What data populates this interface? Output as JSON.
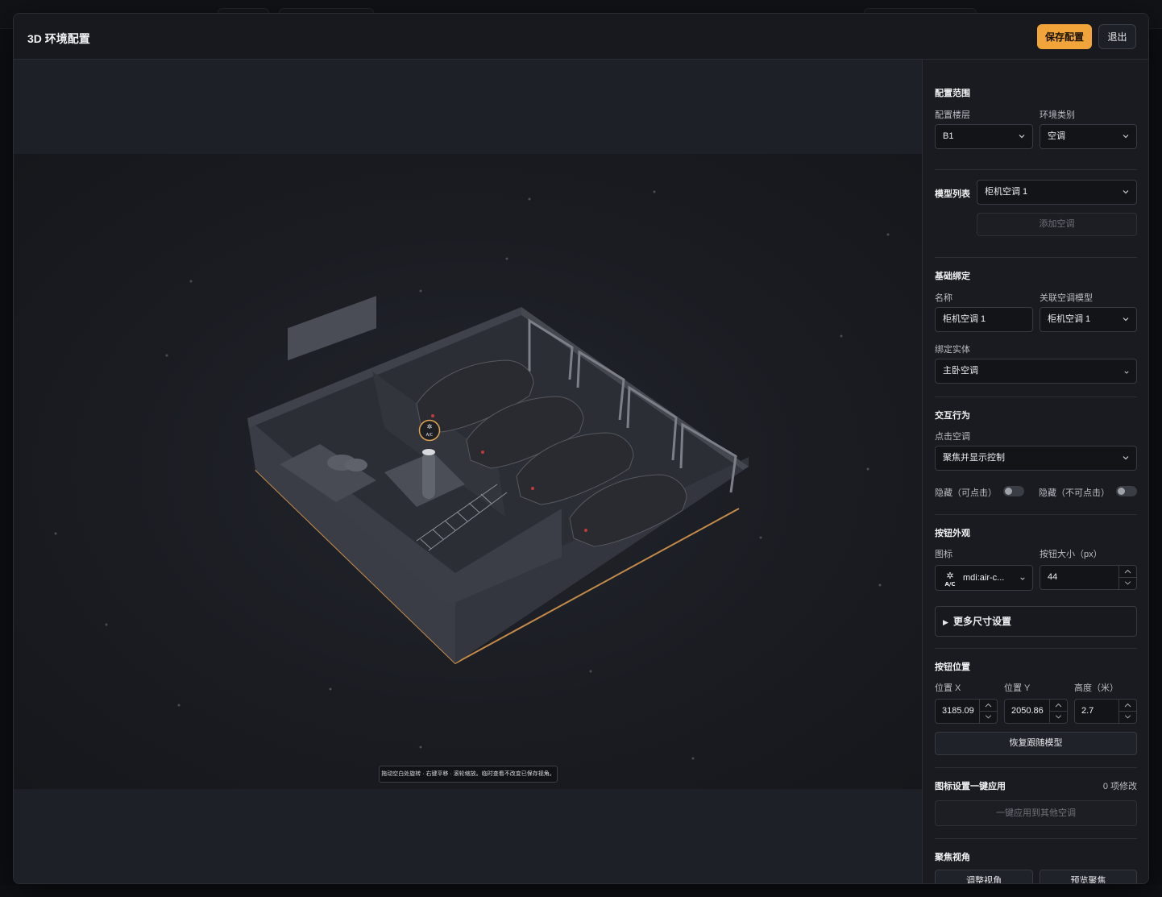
{
  "modal": {
    "title": "3D 环境配置",
    "save_label": "保存配置",
    "exit_label": "退出"
  },
  "viewport": {
    "hint": "拖动空白处旋转 · 右键平移 · 滚轮缩放。临时查看不改变已保存视角。",
    "ac_marker": "A/C"
  },
  "panel": {
    "scope": {
      "title": "配置范围",
      "floor_label": "配置楼层",
      "floor_value": "B1",
      "env_label": "环境类别",
      "env_value": "空调"
    },
    "models": {
      "title": "模型列表",
      "selected": "柜机空调 1",
      "add_label": "添加空调"
    },
    "binding": {
      "title": "基础绑定",
      "name_label": "名称",
      "name_value": "柜机空调 1",
      "model_label": "关联空调模型",
      "model_value": "柜机空调 1",
      "entity_label": "绑定实体",
      "entity_value": "主卧空调"
    },
    "interaction": {
      "title": "交互行为",
      "click_label": "点击空调",
      "click_value": "聚焦并显示控制",
      "hide_clickable": "隐藏（可点击）",
      "hide_unclickable": "隐藏（不可点击）"
    },
    "appearance": {
      "title": "按钮外观",
      "icon_label": "图标",
      "icon_value": "mdi:air-c...",
      "size_label": "按钮大小（px）",
      "size_value": "44",
      "more_label": "更多尺寸设置"
    },
    "position": {
      "title": "按钮位置",
      "x_label": "位置 X",
      "x_value": "3185.09",
      "y_label": "位置 Y",
      "y_value": "2050.86",
      "h_label": "高度（米）",
      "h_value": "2.7",
      "restore_label": "恢复跟随模型"
    },
    "apply": {
      "title": "图标设置一键应用",
      "count": "0 项修改",
      "apply_label": "一键应用到其他空调"
    },
    "focus": {
      "title": "聚焦视角",
      "adjust_label": "调整视角",
      "preview_label": "预览聚焦"
    }
  },
  "colors": {
    "accent": "#f0a43a",
    "background": "#17191e",
    "panel": "#191b20"
  }
}
